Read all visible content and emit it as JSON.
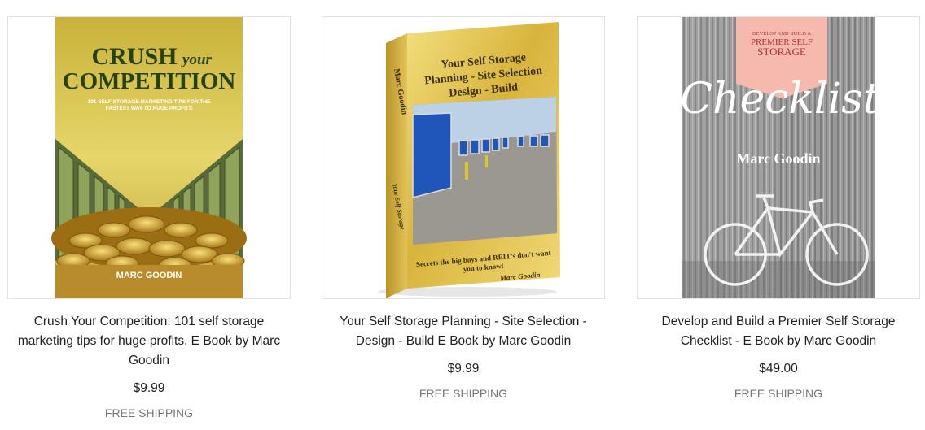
{
  "products": [
    {
      "title": "Crush Your Competition: 101 self storage marketing tips for huge profits. E Book by Marc Goodin",
      "price": "$9.99",
      "shipping": "FREE SHIPPING",
      "cover": {
        "title_line1": "CRUSH",
        "title_italic": "your",
        "title_line2": "COMPETITION",
        "subtitle_line1": "101 SELF STORAGE MARKETING TIPS FOR THE",
        "subtitle_line2": "FASTEST WAY TO HUGE PROFITS",
        "author": "MARC GOODIN"
      }
    },
    {
      "title": "Your Self Storage Planning - Site Selection - Design - Build E Book by Marc Goodin",
      "price": "$9.99",
      "shipping": "FREE SHIPPING",
      "cover": {
        "title_line1": "Your Self Storage",
        "title_line2": "Planning - Site Selection",
        "title_line3": "Design - Build",
        "tagline_line1": "Secrets the big boys and REIT's don't want",
        "tagline_line2": "you to know!",
        "author": "Marc Goodin",
        "spine_author": "Marc Goodin",
        "spine_title": "Your Self Storage"
      }
    },
    {
      "title": "Develop and Build a Premier Self Storage Checklist - E Book by Marc Goodin",
      "price": "$49.00",
      "shipping": "FREE SHIPPING",
      "cover": {
        "banner_line1": "DEVELOP AND BUILD A",
        "banner_line2": "PREMIER SELF",
        "banner_line3": "STORAGE",
        "script_title": "Checklist",
        "author": "Marc Goodin"
      }
    }
  ]
}
